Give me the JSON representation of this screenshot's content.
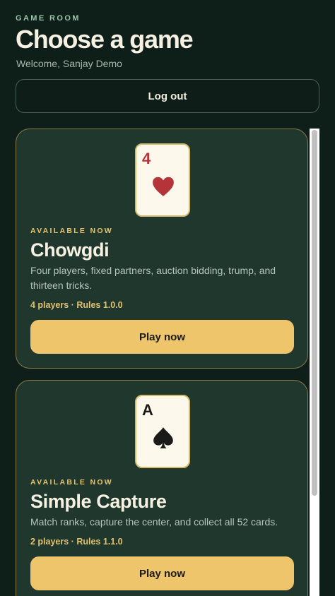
{
  "header": {
    "eyebrow": "GAME ROOM",
    "title": "Choose a game",
    "welcome": "Welcome, Sanjay Demo",
    "logout_label": "Log out"
  },
  "games": [
    {
      "card_rank": "4",
      "card_suit": "heart-icon",
      "status": "AVAILABLE NOW",
      "name": "Chowgdi",
      "description": "Four players, fixed partners, auction bidding, trump, and thirteen tricks.",
      "meta": "4 players · Rules 1.0.0",
      "play_label": "Play now"
    },
    {
      "card_rank": "A",
      "card_suit": "spade-icon",
      "status": "AVAILABLE NOW",
      "name": "Simple Capture",
      "description": "Match ranks, capture the center, and collect all 52 cards.",
      "meta": "2 players · Rules 1.1.0",
      "play_label": "Play now"
    }
  ],
  "colors": {
    "background": "#0e1e19",
    "card_background": "#1f372c",
    "card_border": "#8a7a45",
    "accent": "#efc56c",
    "heart_red": "#b5343a"
  }
}
